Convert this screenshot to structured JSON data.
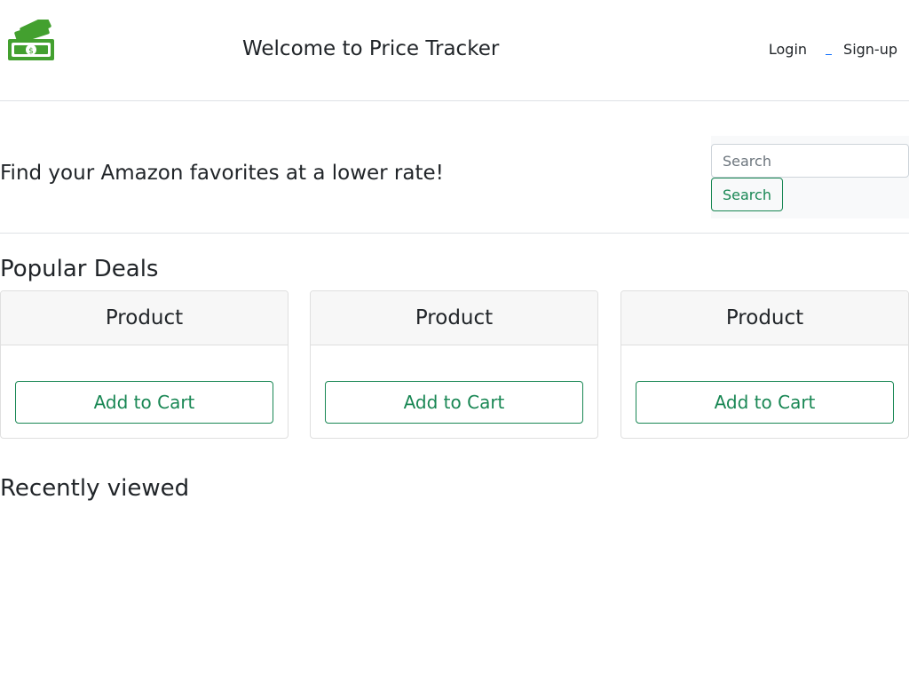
{
  "header": {
    "title": "Welcome to Price Tracker",
    "logo_icon": "money-stack-icon",
    "login_label": "Login",
    "signup_label": "Sign-up"
  },
  "hero": {
    "tagline": "Find your Amazon favorites at a lower rate!",
    "search_placeholder": "Search",
    "search_button_label": "Search"
  },
  "popular": {
    "title": "Popular Deals",
    "cards": [
      {
        "title": "Product",
        "button_label": "Add to Cart"
      },
      {
        "title": "Product",
        "button_label": "Add to Cart"
      },
      {
        "title": "Product",
        "button_label": "Add to Cart"
      }
    ]
  },
  "recent": {
    "title": "Recently viewed"
  },
  "colors": {
    "accent": "#198754",
    "logo_green": "#43a02f"
  }
}
